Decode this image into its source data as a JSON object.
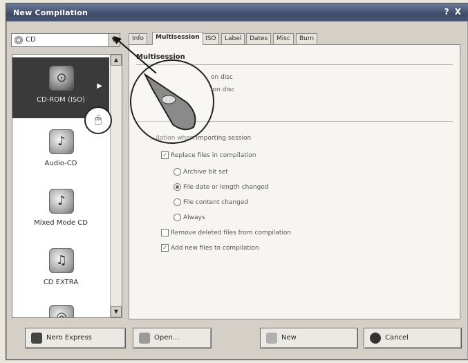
{
  "window": {
    "title": "New Compilation",
    "help": "?",
    "close": "X"
  },
  "combo": {
    "value": "CD",
    "arrow": "▼"
  },
  "types": [
    {
      "label": "CD-ROM (ISO)",
      "glyph": "⊙"
    },
    {
      "label": "Audio-CD",
      "glyph": "♪"
    },
    {
      "label": "Mixed Mode CD",
      "glyph": "♪"
    },
    {
      "label": "CD EXTRA",
      "glyph": "♫"
    },
    {
      "label": "",
      "glyph": "◎"
    }
  ],
  "tabs": [
    "Info",
    "Multisession",
    "ISO",
    "Label",
    "Dates",
    "Misc",
    "Burn"
  ],
  "panel": {
    "title": "Multisession",
    "options_top": [
      "on disc",
      "ion disc"
    ],
    "import": "...ilation when importing session",
    "replace": "Replace files in compilation",
    "radios": [
      "Archive bit set",
      "File date or length changed",
      "File content changed",
      "Always"
    ],
    "remove": "Remove deleted files from compilation",
    "add": "Add new files to compilation"
  },
  "buttons": {
    "nero_express": "Nero Express",
    "open": "Open...",
    "new": "New",
    "cancel": "Cancel"
  },
  "colors": {
    "selected_item": "#3a3a3a",
    "title_bar": "#3e4a68"
  },
  "icons": {
    "pointer": "hand-pointer-icon",
    "mouse": "mouse-click-icon"
  }
}
